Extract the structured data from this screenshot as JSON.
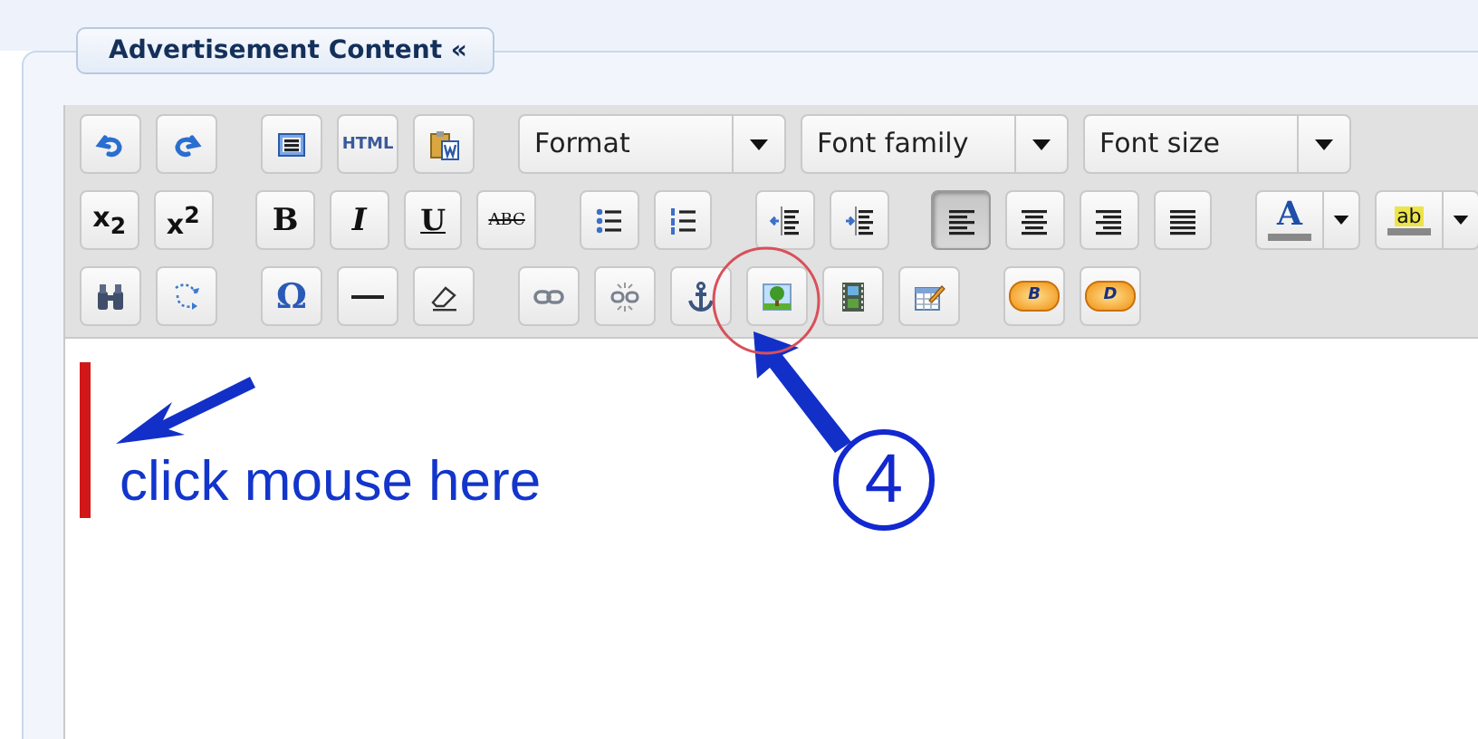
{
  "panel": {
    "title": "Advertisement Content «"
  },
  "toolbar": {
    "rows": [
      [
        {
          "kind": "button",
          "pressed": false
        },
        {
          "kind": "button",
          "pressed": false
        },
        {
          "kind": "gap"
        },
        {
          "kind": "button",
          "pressed": false
        },
        {
          "kind": "button",
          "label": "HTML",
          "pressed": false
        },
        {
          "kind": "button",
          "pressed": false
        },
        {
          "kind": "gap"
        },
        {
          "kind": "dropdown",
          "label": "Format"
        },
        {
          "kind": "dropdown",
          "label": "Font family"
        },
        {
          "kind": "dropdown",
          "label": "Font size"
        }
      ],
      [
        {
          "kind": "button",
          "label": "x$_{2}$",
          "pressed": false
        },
        {
          "kind": "button",
          "label": "x$^{2}$",
          "pressed": false
        },
        {
          "kind": "gap"
        },
        {
          "kind": "button",
          "label": "B",
          "pressed": false
        },
        {
          "kind": "button",
          "label": "I",
          "pressed": false
        },
        {
          "kind": "button",
          "label": "U",
          "pressed": false
        },
        {
          "kind": "button",
          "label": "ABC",
          "pressed": false
        },
        {
          "kind": "gap"
        },
        {
          "kind": "button",
          "pressed": false
        },
        {
          "kind": "button",
          "pressed": false
        },
        {
          "kind": "gap"
        },
        {
          "kind": "button",
          "pressed": false
        },
        {
          "kind": "button",
          "pressed": false
        },
        {
          "kind": "gap"
        },
        {
          "kind": "button",
          "pressed": true
        },
        {
          "kind": "button",
          "pressed": false
        },
        {
          "kind": "button",
          "pressed": false
        },
        {
          "kind": "button",
          "pressed": false
        },
        {
          "kind": "gap"
        },
        {
          "kind": "split",
          "label": "A"
        },
        {
          "kind": "split",
          "label": "ab"
        }
      ],
      [
        {
          "kind": "button",
          "pressed": false
        },
        {
          "kind": "button",
          "pressed": false
        },
        {
          "kind": "gap"
        },
        {
          "kind": "button",
          "label": "Ω",
          "pressed": false
        },
        {
          "kind": "button",
          "pressed": false
        },
        {
          "kind": "button",
          "pressed": false
        },
        {
          "kind": "gap"
        },
        {
          "kind": "button",
          "pressed": false
        },
        {
          "kind": "button",
          "pressed": false
        },
        {
          "kind": "button",
          "pressed": false
        },
        {
          "kind": "button",
          "pressed": false
        },
        {
          "kind": "button",
          "pressed": false
        },
        {
          "kind": "button",
          "pressed": false
        },
        {
          "kind": "gap"
        },
        {
          "kind": "pill",
          "label": "B",
          "pressed": false
        },
        {
          "kind": "pill",
          "label": "D",
          "pressed": false
        }
      ]
    ]
  },
  "annotations": {
    "hint": "click mouse here",
    "step": "4"
  }
}
